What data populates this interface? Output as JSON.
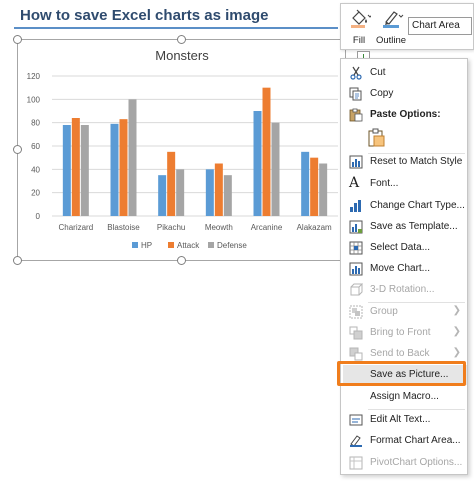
{
  "page": {
    "title": "How to save Excel charts as image"
  },
  "toolbar": {
    "fill_label": "Fill",
    "outline_label": "Outline",
    "element_selector_value": "Chart Area"
  },
  "context_menu": {
    "items": [
      {
        "label": "Cut",
        "icon": "scissors-icon",
        "enabled": true
      },
      {
        "label": "Copy",
        "icon": "copy-icon",
        "enabled": true
      },
      {
        "label": "Paste Options:",
        "icon": "paste-icon",
        "enabled": true
      },
      {
        "label": "Reset to Match Style",
        "icon": "reset-style-icon",
        "enabled": true
      },
      {
        "label": "Font...",
        "icon": "font-icon",
        "enabled": true
      },
      {
        "label": "Change Chart Type...",
        "icon": "chart-type-icon",
        "enabled": true
      },
      {
        "label": "Save as Template...",
        "icon": "template-icon",
        "enabled": true
      },
      {
        "label": "Select Data...",
        "icon": "select-data-icon",
        "enabled": true
      },
      {
        "label": "Move Chart...",
        "icon": "move-chart-icon",
        "enabled": true
      },
      {
        "label": "3-D Rotation...",
        "icon": "rotation-3d-icon",
        "enabled": false
      },
      {
        "label": "Group",
        "icon": "group-icon",
        "enabled": false,
        "submenu": true
      },
      {
        "label": "Bring to Front",
        "icon": "bring-front-icon",
        "enabled": false,
        "submenu": true
      },
      {
        "label": "Send to Back",
        "icon": "send-back-icon",
        "enabled": false,
        "submenu": true
      },
      {
        "label": "Save as Picture...",
        "icon": "",
        "enabled": true,
        "highlighted": true
      },
      {
        "label": "Assign Macro...",
        "icon": "",
        "enabled": true
      },
      {
        "label": "Edit Alt Text...",
        "icon": "alt-text-icon",
        "enabled": true
      },
      {
        "label": "Format Chart Area...",
        "icon": "format-area-icon",
        "enabled": true
      },
      {
        "label": "PivotChart Options...",
        "icon": "pivot-options-icon",
        "enabled": false
      }
    ]
  },
  "colors": {
    "hp": "#5b9bd5",
    "attack": "#ed7d31",
    "defense": "#a5a5a5",
    "highlight_border": "#f07d1c"
  },
  "chart_data": {
    "type": "bar",
    "title": "Monsters",
    "categories": [
      "Charizard",
      "Blastoise",
      "Pikachu",
      "Meowth",
      "Arcanine",
      "Alakazam"
    ],
    "series": [
      {
        "name": "HP",
        "values": [
          78,
          79,
          35,
          40,
          90,
          55
        ]
      },
      {
        "name": "Attack",
        "values": [
          84,
          83,
          55,
          45,
          110,
          50
        ]
      },
      {
        "name": "Defense",
        "values": [
          78,
          100,
          40,
          35,
          80,
          45
        ]
      }
    ],
    "ylim": [
      0,
      120
    ],
    "yticks": [
      "0",
      "20",
      "40",
      "60",
      "80",
      "100",
      "120"
    ],
    "grid": true,
    "legend": "bottom"
  }
}
